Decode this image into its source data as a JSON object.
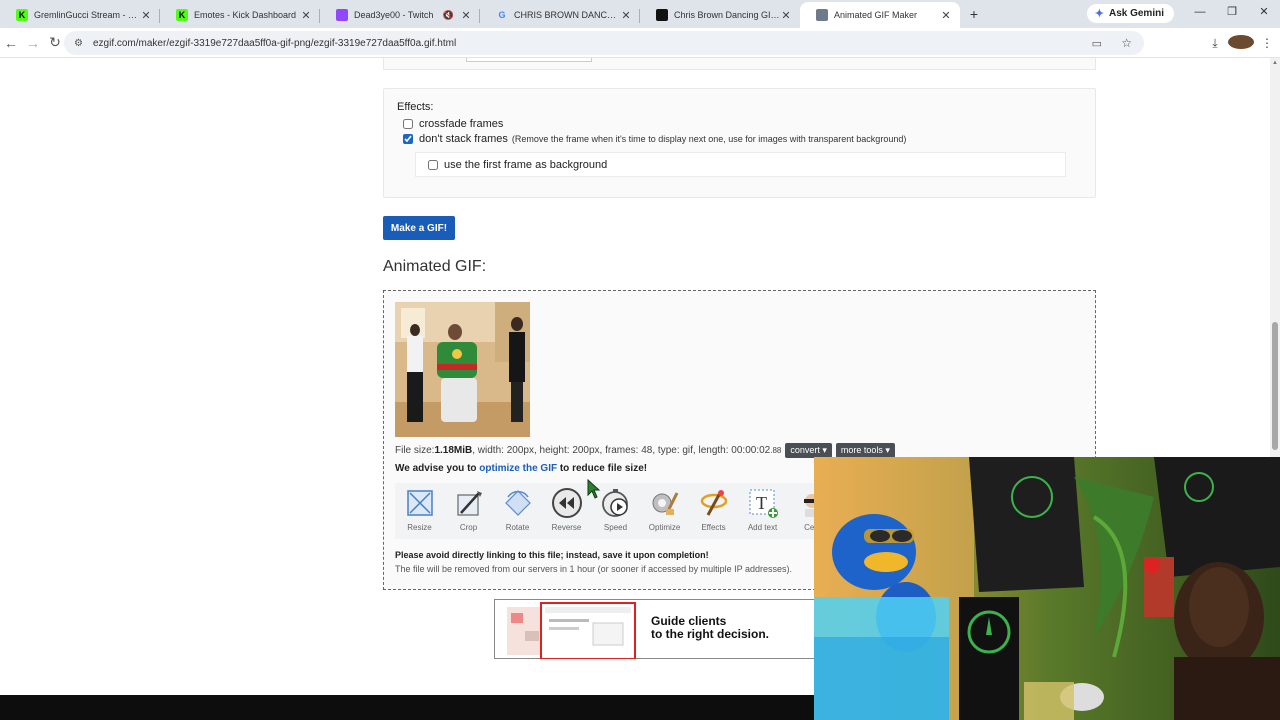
{
  "browser": {
    "tabs": [
      {
        "title": "GremlinGucci Stream - Watch i...",
        "favicon": "K",
        "favicon_color": "#53fc18"
      },
      {
        "title": "Emotes - Kick Dashboard",
        "favicon": "K",
        "favicon_color": "#53fc18"
      },
      {
        "title": "Dead3ye00 - Twitch",
        "favicon": "",
        "favicon_color": "#9146ff"
      },
      {
        "title": "CHRIS BROWN DANCE GIF - Go...",
        "favicon": "G",
        "favicon_color": "#ffffff"
      },
      {
        "title": "Chris Brown Dancing GIFs - Find...",
        "favicon": "",
        "favicon_color": "#111111"
      },
      {
        "title": "Animated GIF Maker",
        "favicon": "",
        "favicon_color": "#6d7a8a"
      }
    ],
    "new_tab_icon": "plus-icon",
    "ask_gemini": "Ask Gemini",
    "url": "ezgif.com/maker/ezgif-3319e727daa5ff0a-gif-png/ezgif-3319e727daa5ff0a.gif.html"
  },
  "effects": {
    "title": "Effects:",
    "crossfade_label": "crossfade frames",
    "crossfade_checked": false,
    "dont_stack_label": "don't stack frames",
    "dont_stack_note": "(Remove the frame when it's time to display next one, use for images with transparent background)",
    "dont_stack_checked": true,
    "first_frame_label": "use the first frame as background",
    "first_frame_checked": false
  },
  "make_button": "Make a GIF!",
  "result": {
    "heading": "Animated GIF:",
    "file_size_label": "File size: ",
    "file_size": "1.18MiB",
    "details": ", width: 200px, height: 200px, frames: 48, type: gif, length: 00:00:02",
    "length_sub": ".88",
    "convert": "convert",
    "more_tools": "more tools",
    "advise_prefix": "We advise you to ",
    "advise_link": "optimize the GIF",
    "advise_suffix": " to reduce file size!",
    "tools": [
      {
        "label": "Resize",
        "icon": "resize-icon"
      },
      {
        "label": "Crop",
        "icon": "crop-icon"
      },
      {
        "label": "Rotate",
        "icon": "rotate-icon"
      },
      {
        "label": "Reverse",
        "icon": "reverse-icon"
      },
      {
        "label": "Speed",
        "icon": "speed-icon"
      },
      {
        "label": "Optimize",
        "icon": "optimize-icon"
      },
      {
        "label": "Effects",
        "icon": "effects-icon"
      },
      {
        "label": "Add text",
        "icon": "add-text-icon"
      },
      {
        "label": "Cen",
        "icon": "censor-icon"
      }
    ],
    "warning": "Please avoid directly linking to this file; instead, save it upon completion!",
    "removal_note": "The file will be removed from our servers in 1 hour (or sooner if accessed by multiple IP addresses)."
  },
  "ad": {
    "line1": "Guide clients",
    "line2": "to the right decision."
  }
}
